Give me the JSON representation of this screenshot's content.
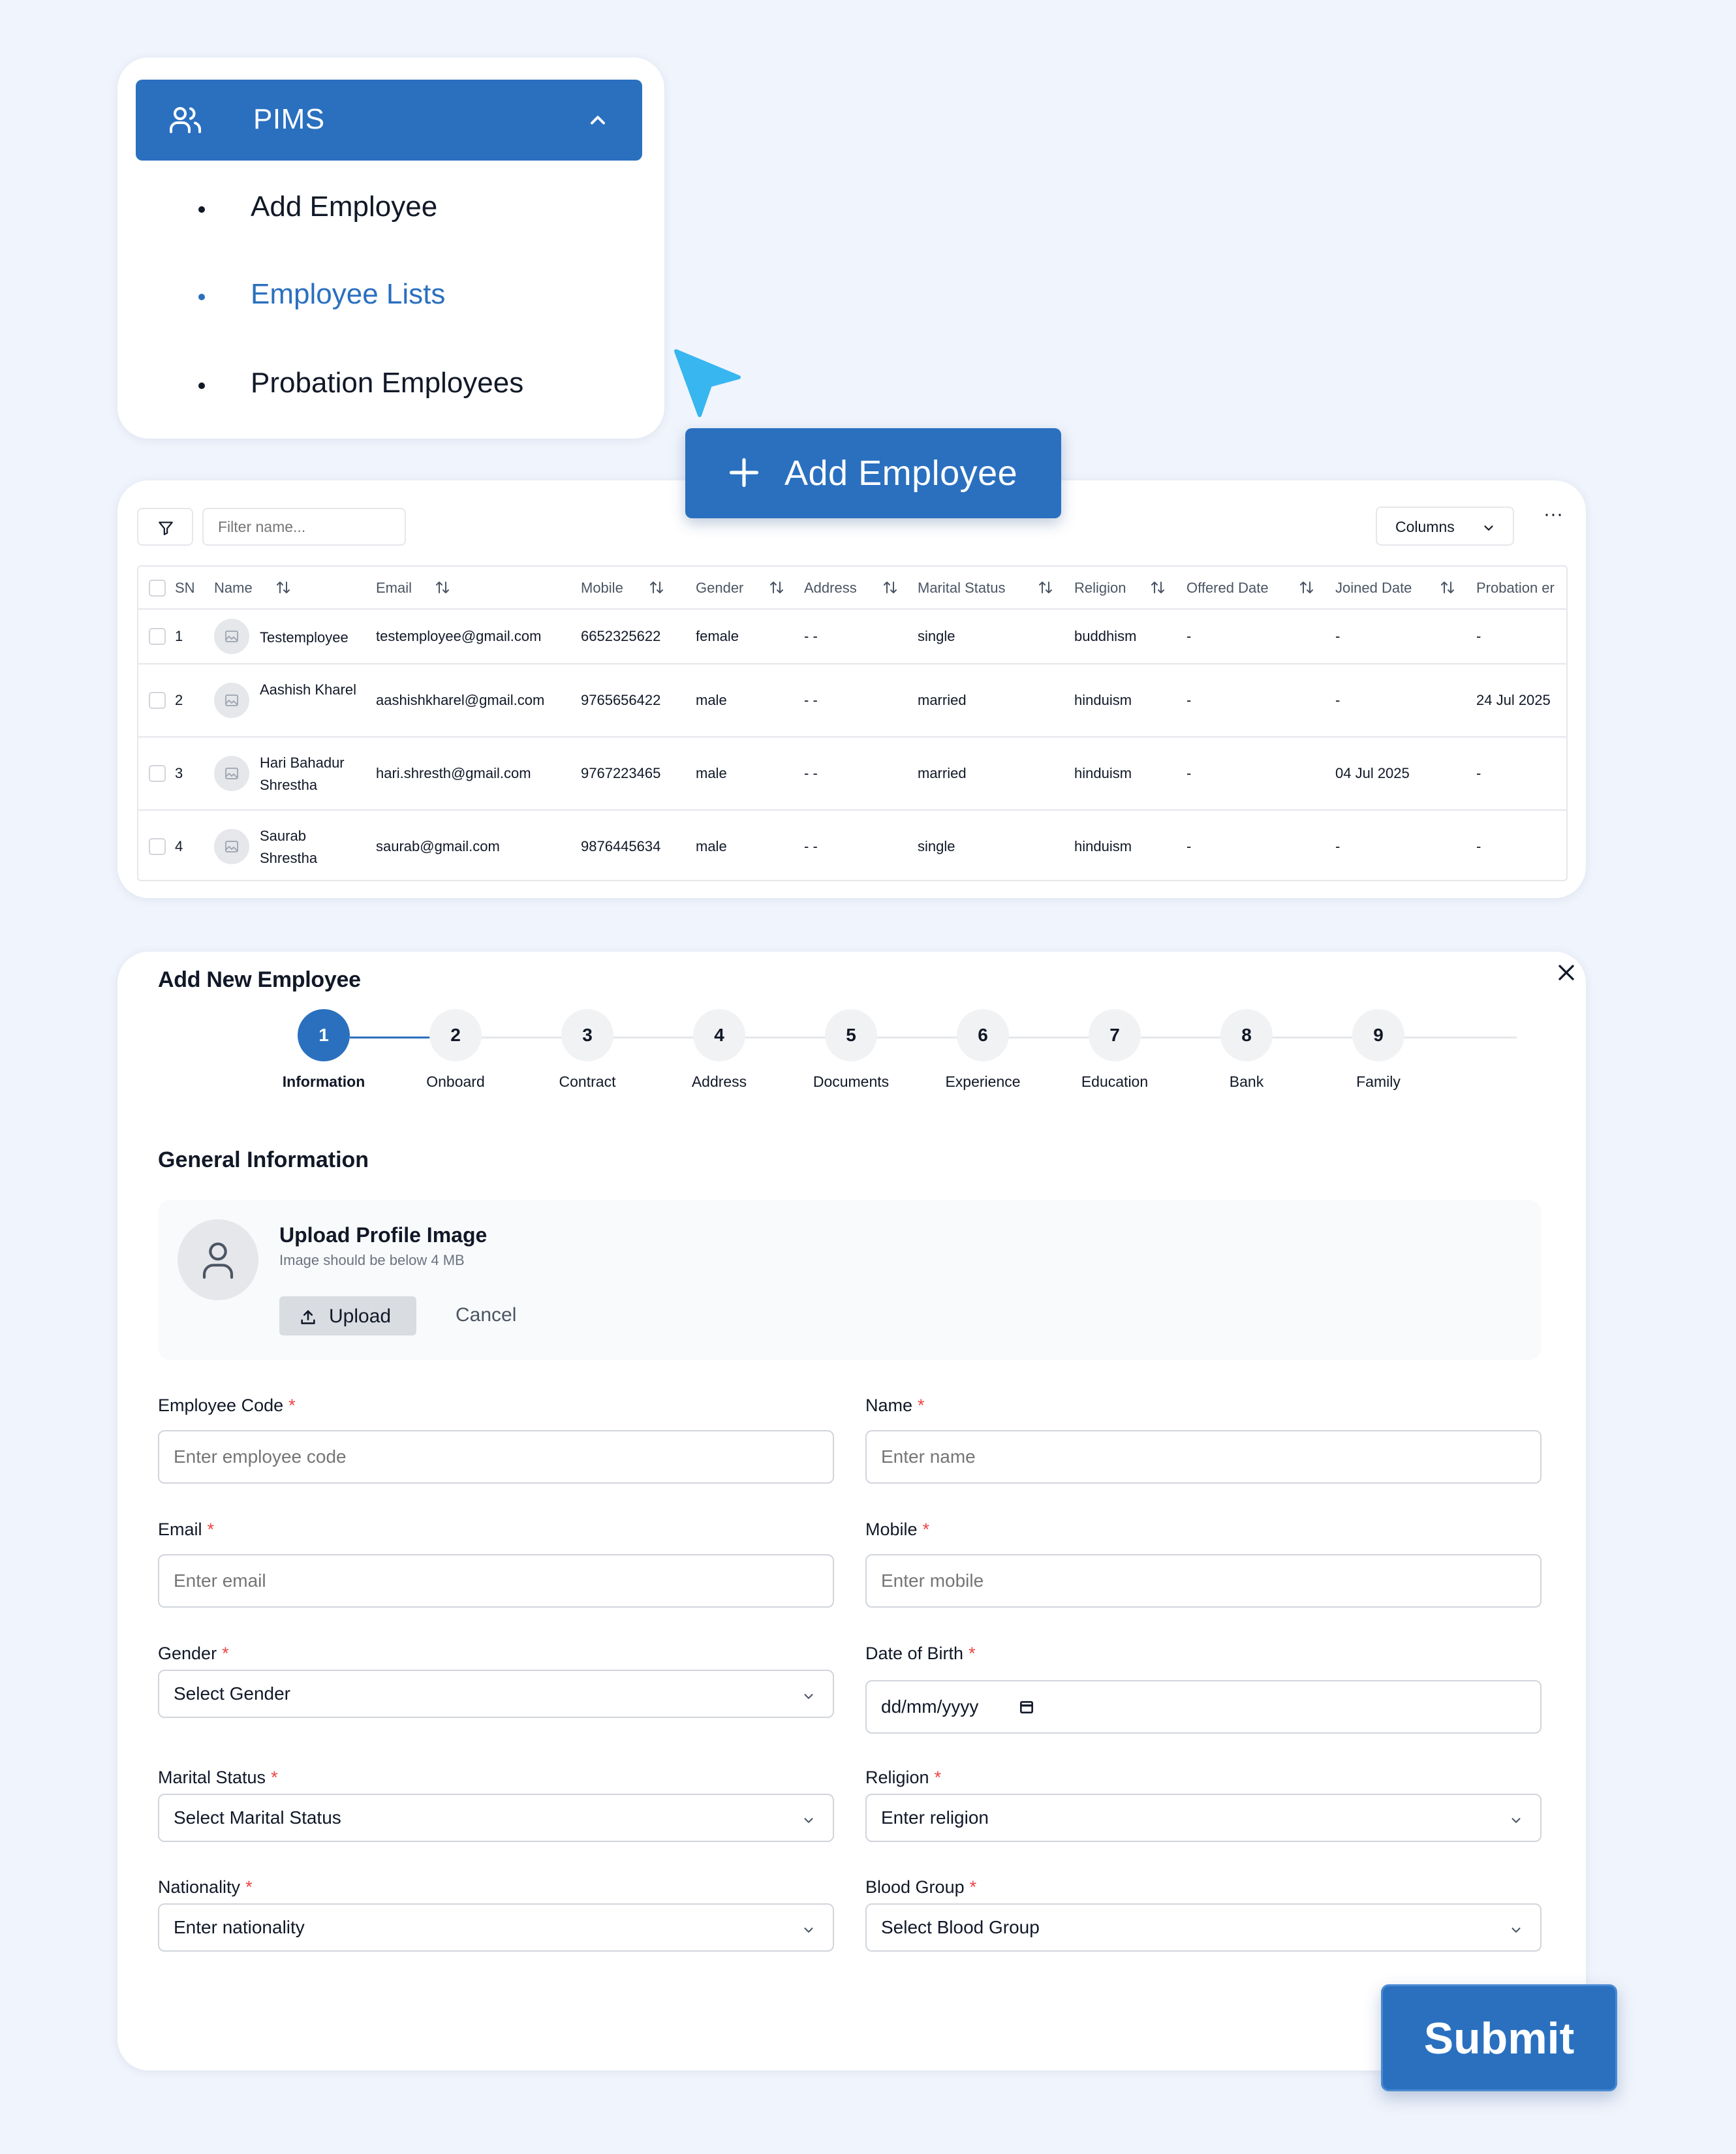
{
  "sidebar": {
    "title": "PIMS",
    "items": [
      {
        "label": "Add Employee",
        "active": false
      },
      {
        "label": "Employee Lists",
        "active": true
      },
      {
        "label": "Probation Employees",
        "active": false
      }
    ]
  },
  "floating": {
    "add_employee_label": "Add Employee",
    "submit_label": "Submit"
  },
  "table": {
    "filter_placeholder": "Filter name...",
    "columns_label": "Columns",
    "more_label": "···",
    "headers": [
      "SN",
      "Name",
      "Email",
      "Mobile",
      "Gender",
      "Address",
      "Marital Status",
      "Religion",
      "Offered Date",
      "Joined Date",
      "Probation er"
    ],
    "rows": [
      {
        "sn": "1",
        "name": "Testemployee",
        "email": "testemployee@gmail.com",
        "mobile": "6652325622",
        "gender": "female",
        "address": "- -",
        "marital": "single",
        "religion": "buddhism",
        "offered": "-",
        "joined": "-",
        "probation": "-"
      },
      {
        "sn": "2",
        "name": "Aashish Kharel",
        "email": "aashishkharel@gmail.com",
        "mobile": "9765656422",
        "gender": "male",
        "address": "- -",
        "marital": "married",
        "religion": "hinduism",
        "offered": "-",
        "joined": "-",
        "probation": "24 Jul 2025"
      },
      {
        "sn": "3",
        "name": "Hari Bahadur Shrestha",
        "email": "hari.shresth@gmail.com",
        "mobile": "9767223465",
        "gender": "male",
        "address": "- -",
        "marital": "married",
        "religion": "hinduism",
        "offered": "-",
        "joined": "04 Jul 2025",
        "probation": "-"
      },
      {
        "sn": "4",
        "name": "Saurab Shrestha",
        "email": "saurab@gmail.com",
        "mobile": "9876445634",
        "gender": "male",
        "address": "- -",
        "marital": "single",
        "religion": "hinduism",
        "offered": "-",
        "joined": "-",
        "probation": "-"
      }
    ]
  },
  "form": {
    "title": "Add New Employee",
    "steps": [
      {
        "num": "1",
        "label": "Information",
        "active": true
      },
      {
        "num": "2",
        "label": "Onboard",
        "active": false
      },
      {
        "num": "3",
        "label": "Contract",
        "active": false
      },
      {
        "num": "4",
        "label": "Address",
        "active": false
      },
      {
        "num": "5",
        "label": "Documents",
        "active": false
      },
      {
        "num": "6",
        "label": "Experience",
        "active": false
      },
      {
        "num": "7",
        "label": "Education",
        "active": false
      },
      {
        "num": "8",
        "label": "Bank",
        "active": false
      },
      {
        "num": "9",
        "label": "Family",
        "active": false
      }
    ],
    "section_title": "General Information",
    "upload": {
      "title": "Upload Profile Image",
      "subtitle": "Image should be below 4 MB",
      "upload_label": "Upload",
      "cancel_label": "Cancel"
    },
    "fields": {
      "employee_code": {
        "label": "Employee Code",
        "required": "*",
        "placeholder": "Enter employee code"
      },
      "name": {
        "label": "Name",
        "required": "*",
        "placeholder": "Enter name"
      },
      "email": {
        "label": "Email",
        "required": "*",
        "placeholder": "Enter email"
      },
      "mobile": {
        "label": "Mobile",
        "required": "*",
        "placeholder": "Enter mobile"
      },
      "gender": {
        "label": "Gender",
        "required": "*",
        "value": "Select Gender"
      },
      "dob": {
        "label": "Date of Birth",
        "required": "*",
        "value": "dd/mm/yyyy"
      },
      "marital_status": {
        "label": "Marital Status",
        "required": "*",
        "value": "Select Marital Status"
      },
      "religion": {
        "label": "Religion",
        "required": "*",
        "value": "Enter religion"
      },
      "nationality": {
        "label": "Nationality",
        "required": "*",
        "value": "Enter nationality"
      },
      "blood_group": {
        "label": "Blood Group",
        "required": "*",
        "value": "Select Blood Group"
      }
    }
  },
  "colors": {
    "accent": "#2a70bf",
    "background": "#f0f4fc",
    "cursor": "#38b6f0",
    "required": "#ef4444"
  },
  "icons": [
    "users-icon",
    "chevron-up-icon",
    "cursor-pointer-icon",
    "plus-icon",
    "filter-icon",
    "chevron-down-icon",
    "sort-icon",
    "image-placeholder-icon",
    "close-icon",
    "user-icon",
    "upload-icon",
    "calendar-icon"
  ]
}
